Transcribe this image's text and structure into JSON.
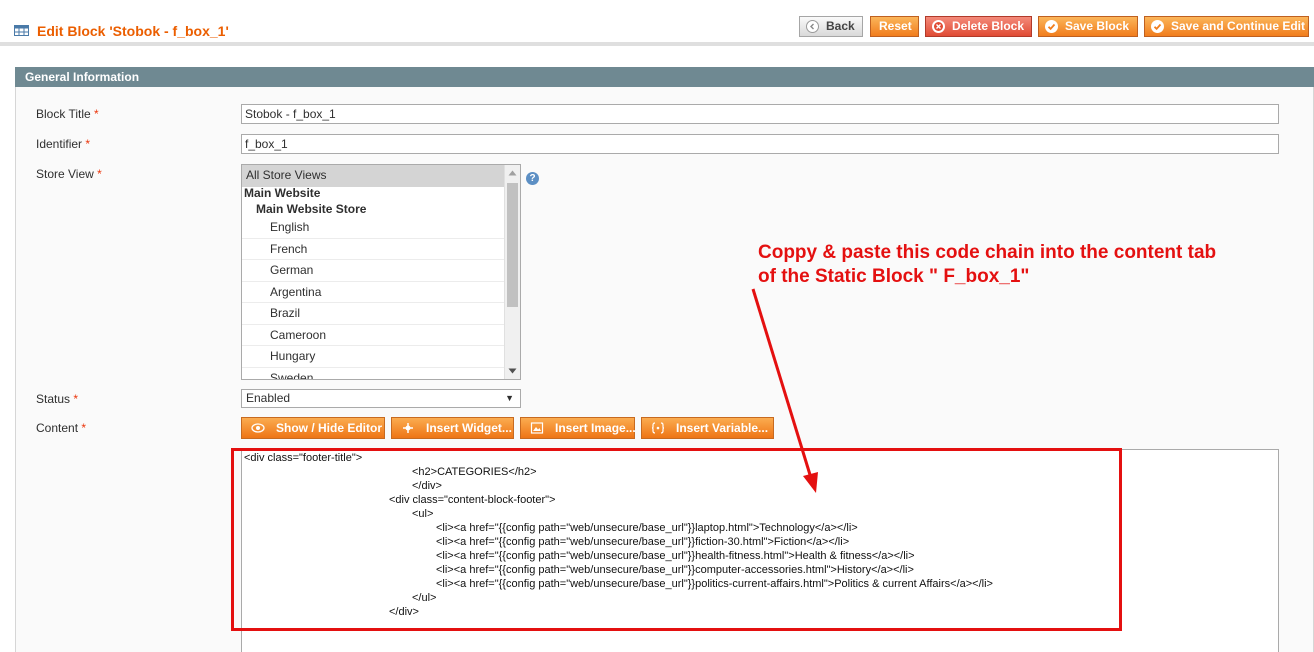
{
  "header": {
    "title": "Edit Block 'Stobok - f_box_1'",
    "buttons": {
      "back": "Back",
      "reset": "Reset",
      "delete": "Delete Block",
      "save": "Save Block",
      "save_continue": "Save and Continue Edit"
    }
  },
  "section": {
    "title": "General Information"
  },
  "form": {
    "block_title": {
      "label": "Block Title",
      "required": "*",
      "value": "Stobok - f_box_1"
    },
    "identifier": {
      "label": "Identifier",
      "required": "*",
      "value": "f_box_1"
    },
    "store_view": {
      "label": "Store View",
      "required": "*",
      "options": [
        "All Store Views",
        "Main Website",
        "Main Website Store",
        "English",
        "French",
        "German",
        "Argentina",
        "Brazil",
        "Cameroon",
        "Hungary",
        "Sweden"
      ],
      "selected": "All Store Views"
    },
    "status": {
      "label": "Status",
      "required": "*",
      "value": "Enabled"
    },
    "content": {
      "label": "Content",
      "required": "*",
      "buttons": {
        "show_hide": "Show / Hide Editor",
        "insert_widget": "Insert Widget...",
        "insert_image": "Insert Image...",
        "insert_variable": "Insert Variable..."
      },
      "code_lines": [
        "<div class=\"footer-title\">",
        "<h2>CATEGORIES</h2>",
        "</div>",
        "<div class=\"content-block-footer\">",
        "<ul>",
        "<li><a href=\"{{config path=\"web/unsecure/base_url\"}}laptop.html\">Technology</a></li>",
        "<li><a href=\"{{config path=\"web/unsecure/base_url\"}}fiction-30.html\">Fiction</a></li>",
        "<li><a href=\"{{config path=\"web/unsecure/base_url\"}}health-fitness.html\">Health & fitness</a></li>",
        "<li><a href=\"{{config path=\"web/unsecure/base_url\"}}computer-accessories.html\">History</a></li>",
        "<li><a href=\"{{config path=\"web/unsecure/base_url\"}}politics-current-affairs.html\">Politics & current Affairs</a></li>",
        "</ul>",
        "</div>"
      ]
    }
  },
  "annotation": {
    "text_line1": "Coppy & paste this code chain into the content tab",
    "text_line2": "of the Static Block \" F_box_1\"",
    "color": "#e41010"
  },
  "colors": {
    "accent": "#eb5e00",
    "section_bar": "#6f8992",
    "button": "#f17d1d",
    "delete": "#e04b34"
  }
}
